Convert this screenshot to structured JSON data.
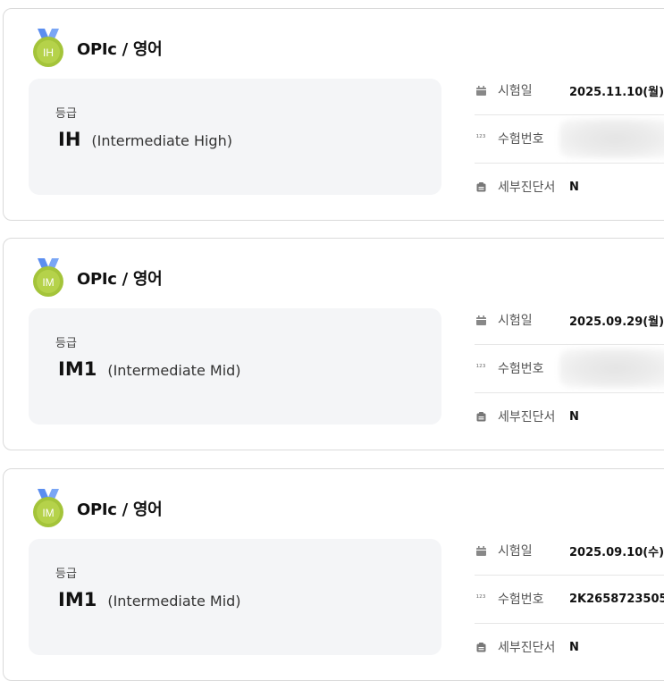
{
  "cards": [
    {
      "medal": "IH",
      "title": "OPIc / 영어",
      "grade_label": "등급",
      "grade_code": "IH",
      "grade_desc": "(Intermediate High)",
      "date_label": "시험일",
      "date": "2025.11.10(월)",
      "number_label": "수험번호",
      "number": "",
      "number_blurred": true,
      "diagnosis_label": "세부진단서",
      "diagnosis": "N"
    },
    {
      "medal": "IM",
      "title": "OPIc / 영어",
      "grade_label": "등급",
      "grade_code": "IM1",
      "grade_desc": "(Intermediate Mid)",
      "date_label": "시험일",
      "date": "2025.09.29(월)",
      "number_label": "수험번호",
      "number": "",
      "number_blurred": true,
      "diagnosis_label": "세부진단서",
      "diagnosis": "N"
    },
    {
      "medal": "IM",
      "title": "OPIc / 영어",
      "grade_label": "등급",
      "grade_code": "IM1",
      "grade_desc": "(Intermediate Mid)",
      "date_label": "시험일",
      "date": "2025.09.10(수)",
      "number_label": "수험번호",
      "number": "2K2658723505",
      "number_blurred": false,
      "diagnosis_label": "세부진단서",
      "diagnosis": "N"
    }
  ],
  "icons": {
    "date": "calendar-icon",
    "number": "number-123-icon",
    "diagnosis": "document-icon",
    "medal": "medal-icon"
  },
  "colors": {
    "medal_green": "#a4c43a",
    "ribbon_blue": "#5b8ef0",
    "grade_box_bg": "#f4f5f7"
  }
}
